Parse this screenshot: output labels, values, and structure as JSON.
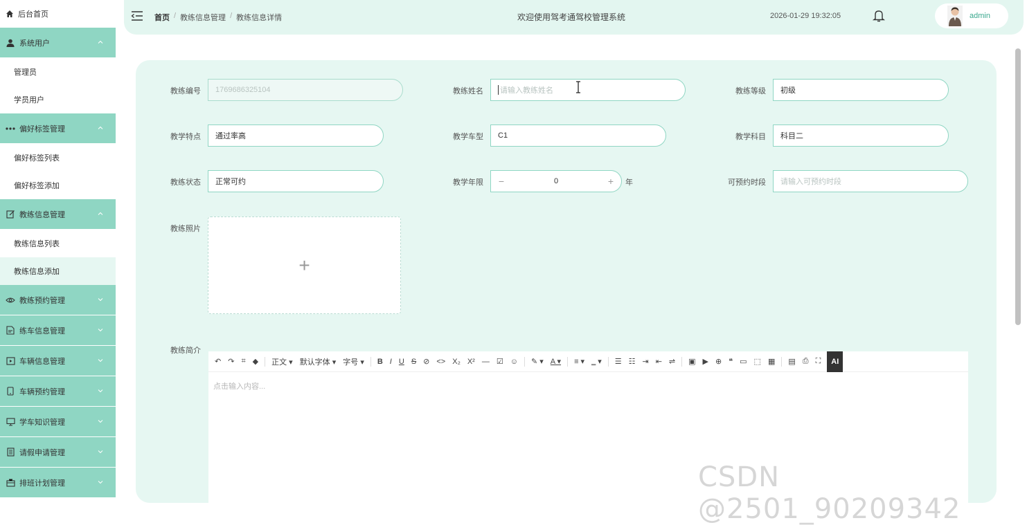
{
  "sidebar": {
    "home": "后台首页",
    "groups": [
      {
        "label": "系统用户",
        "icon": "user-icon",
        "expanded": true,
        "items": [
          "管理员",
          "学员用户"
        ]
      },
      {
        "label": "偏好标签管理",
        "icon": "more-dots-icon",
        "expanded": true,
        "items": [
          "偏好标签列表",
          "偏好标签添加"
        ]
      },
      {
        "label": "教练信息管理",
        "icon": "edit-icon",
        "expanded": true,
        "items": [
          "教练信息列表",
          "教练信息添加"
        ]
      },
      {
        "label": "教练预约管理",
        "icon": "eye-icon",
        "expanded": false,
        "items": []
      },
      {
        "label": "练车信息管理",
        "icon": "document-icon",
        "expanded": false,
        "items": []
      },
      {
        "label": "车辆信息管理",
        "icon": "video-icon",
        "expanded": false,
        "items": []
      },
      {
        "label": "车辆预约管理",
        "icon": "phone-icon",
        "expanded": false,
        "items": []
      },
      {
        "label": "学车知识管理",
        "icon": "monitor-icon",
        "expanded": false,
        "items": []
      },
      {
        "label": "请假申请管理",
        "icon": "notebook-icon",
        "expanded": false,
        "items": []
      },
      {
        "label": "排班计划管理",
        "icon": "briefcase-icon",
        "expanded": false,
        "items": []
      }
    ],
    "active_item": "教练信息添加"
  },
  "header": {
    "breadcrumb": [
      "首页",
      "教练信息管理",
      "教练信息详情"
    ],
    "title": "欢迎使用驾考通驾校管理系统",
    "datetime": "2026-01-29 19:32:05",
    "username": "admin"
  },
  "form": {
    "coach_no": {
      "label": "教练编号",
      "value": "1769686325104"
    },
    "coach_name": {
      "label": "教练姓名",
      "placeholder": "请输入教练姓名"
    },
    "coach_level": {
      "label": "教练等级",
      "value": "初级"
    },
    "teaching_feature": {
      "label": "教学特点",
      "value": "通过率高"
    },
    "car_type": {
      "label": "教学车型",
      "value": "C1"
    },
    "subject": {
      "label": "教学科目",
      "value": "科目二"
    },
    "status": {
      "label": "教练状态",
      "value": "正常可约"
    },
    "years": {
      "label": "教学年限",
      "value": "0",
      "minus": "−",
      "plus": "+",
      "unit": "年"
    },
    "bookable_time": {
      "label": "可预约时段",
      "placeholder": "请输入可预约时段"
    },
    "photo": {
      "label": "教练照片",
      "plus": "+"
    },
    "intro": {
      "label": "教练简介",
      "placeholder": "点击输入内容..."
    }
  },
  "editor_toolbar": {
    "undo": "↶",
    "redo": "↷",
    "format_painter": "⌗",
    "clear": "◆",
    "paragraph": "正文 ▾",
    "font": "默认字体 ▾",
    "size": "字号 ▾",
    "bold": "B",
    "italic": "I",
    "underline": "U",
    "strike": "S",
    "link": "⊘",
    "code": "<>",
    "sub": "X₂",
    "sup": "X²",
    "hr": "—",
    "todo": "☑",
    "emoji": "☺",
    "color": "✎ ▾",
    "bgcolor": "A ▾",
    "align": "≡ ▾",
    "lineheight": "‗ ▾",
    "ul": "☰",
    "ol": "☷",
    "indent": "⇥",
    "outdent": "⇤",
    "wrap": "⇌",
    "image": "▣",
    "video": "▶",
    "attach": "⊕",
    "quote": "❝",
    "block": "▭",
    "frame": "⬚",
    "table": "▦",
    "preview": "▤",
    "print": "⎙",
    "fullscreen": "⛶",
    "ai": "AI"
  },
  "watermark": "CSDN @2501_90209342"
}
